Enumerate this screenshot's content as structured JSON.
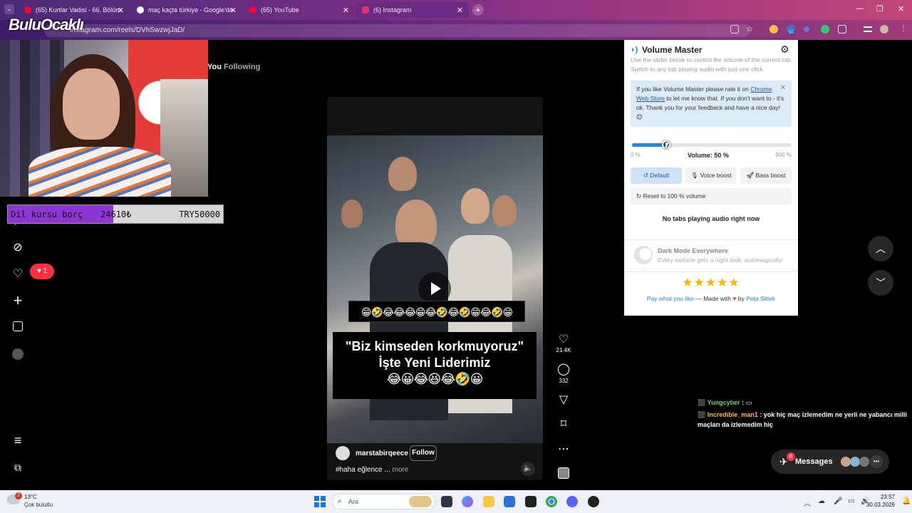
{
  "browser": {
    "tabs": [
      {
        "label": "(65) Kurtlar Vadisi - 66. Bölüm",
        "favicon_color": "#ff0033"
      },
      {
        "label": "maç kaçta türkiye - Google'da",
        "favicon_color": "#ffffff"
      },
      {
        "label": "(65) YouTube",
        "favicon_color": "#ff0033"
      },
      {
        "label": "(6) Instagram",
        "favicon_color": "#e1306c"
      }
    ],
    "url": "instagram.com/reels/DVhSwzwjJaD/",
    "extension_badge": "50"
  },
  "stream_overlay": {
    "logo_text": "BuluOcaklı",
    "goal_label": "Dil kursu borç",
    "goal_current": "24610₺",
    "goal_target": "TRY50000",
    "goal_progress": 0.49
  },
  "instagram": {
    "tab_foryou": "You",
    "tab_following": "Following",
    "notification_count": "1",
    "reel": {
      "emoji_strip": "😁🤣😂😂😂😁😂🤣😂🤣😁😂🤣😁",
      "caption_line1": "\"Biz kimseden korkmuyoruz\"",
      "caption_line2": "İşte Yeni Liderimiz",
      "caption_line3": "😂😀😂😆😂🤣😀",
      "username": "marstabirqeece",
      "follow_label": "Follow",
      "description": "#haha eğlence ...",
      "more_label": "more"
    },
    "likes": "21.4K",
    "comments": "332",
    "messages_label": "Messages",
    "messages_badge": "6"
  },
  "chat": [
    {
      "user": "Yungcyber",
      "message": ""
    },
    {
      "user": "Incredible_man1",
      "message": ": yok hiç maç izlemedim ne yerli ne yabancı milli"
    },
    {
      "user": "",
      "message": "maçları da izlemedim hiç"
    }
  ],
  "volume_master": {
    "title": "Volume Master",
    "description": "Use the slider below to control the volume of the current tab. Switch to any tab playing audio with just one click.",
    "rate_text_before": "If you like Volume Master please rate it on",
    "rate_link": "Chrome Web Store",
    "rate_text_after": "to let me know that. If you don't want to - it's ok. Thank you for your feedback and have a nice day! 😊",
    "min_label": "0 %",
    "max_label": "600 %",
    "volume_label": "Volume: 50 %",
    "volume_percent": 50,
    "volume_max": 600,
    "mode_default": "Default",
    "mode_voice": "Voice boost",
    "mode_bass": "Bass boost",
    "reset_label": "Reset to 100 % volume",
    "no_tabs": "No tabs playing audio right now",
    "promo_title": "Dark Mode Everywhere",
    "promo_sub": "Every website gets a night look, automagically!",
    "stars": "★★★★★",
    "footer_pay": "Pay what you like",
    "footer_mid": "— Made with",
    "footer_heart": "♥",
    "footer_by": "by",
    "footer_author": "Peta Sittek"
  },
  "taskbar": {
    "weather_temp": "13°C",
    "weather_desc": "Çok bulutlu",
    "weather_badge": "2",
    "search_placeholder": "Ara",
    "time": "23:57",
    "date": "30.03.2026"
  }
}
